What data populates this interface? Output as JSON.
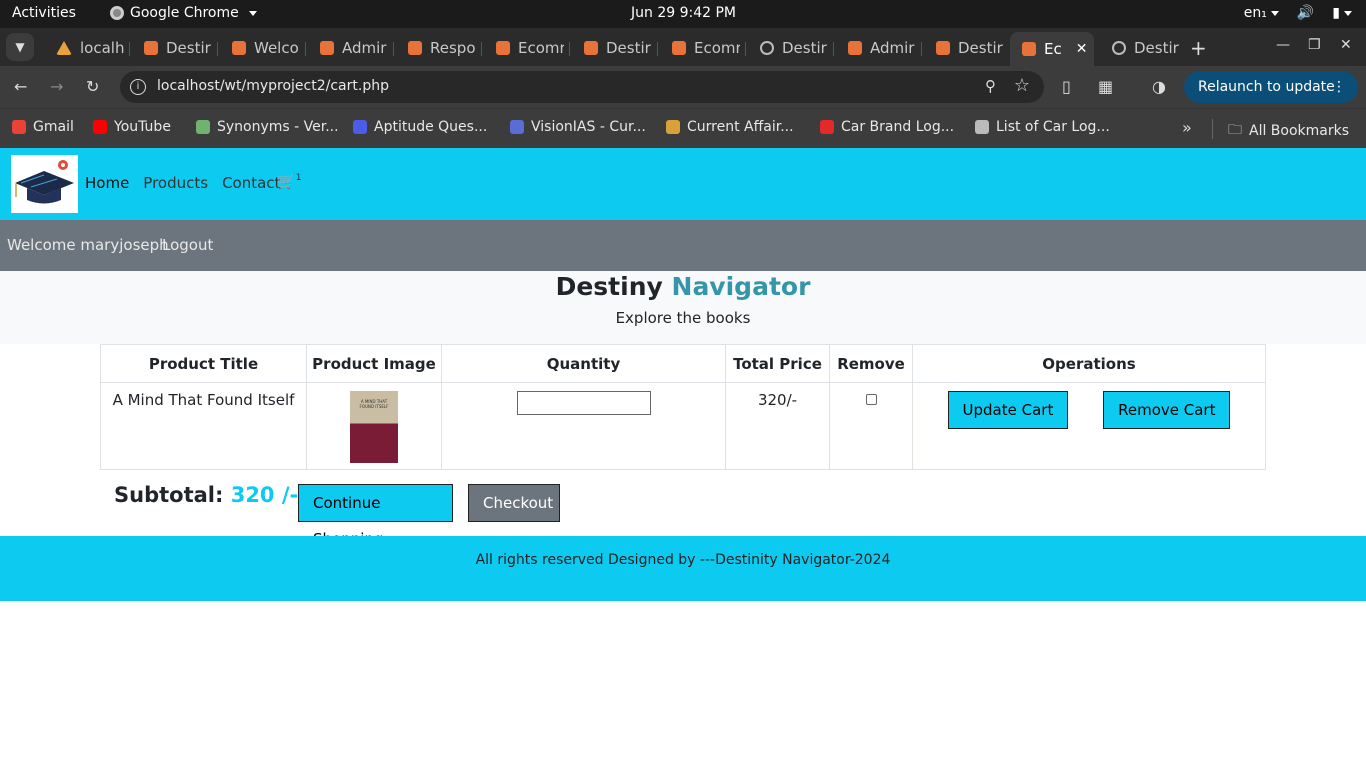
{
  "system_bar": {
    "activities": "Activities",
    "app_name": "Google Chrome",
    "clock": "Jun 29  9:42 PM",
    "keyboard_layout": "en₁"
  },
  "browser": {
    "tabs": [
      {
        "label": "localh",
        "icon": "mountain-icon"
      },
      {
        "label": "Destir",
        "icon": "xampp-icon"
      },
      {
        "label": "Welco",
        "icon": "xampp-icon"
      },
      {
        "label": "Admir",
        "icon": "xampp-icon"
      },
      {
        "label": "Respo",
        "icon": "xampp-icon"
      },
      {
        "label": "Ecomr",
        "icon": "xampp-icon"
      },
      {
        "label": "Destir",
        "icon": "xampp-icon"
      },
      {
        "label": "Ecomr",
        "icon": "xampp-icon"
      },
      {
        "label": "Destir",
        "icon": "globe-icon"
      },
      {
        "label": "Admir",
        "icon": "xampp-icon"
      },
      {
        "label": "Destir",
        "icon": "xampp-icon"
      },
      {
        "label": "Ec",
        "icon": "xampp-icon",
        "active": true
      },
      {
        "label": "Destir",
        "icon": "globe-icon"
      }
    ],
    "url": "localhost/wt/myproject2/cart.php",
    "relaunch_label": "Relaunch to update",
    "bookmarks": [
      {
        "label": "Gmail",
        "color": "#ea4335"
      },
      {
        "label": "YouTube",
        "color": "#ff0000"
      },
      {
        "label": "Synonyms - Ver...",
        "color": "#6fb36f"
      },
      {
        "label": "Aptitude Ques...",
        "color": "#4a5ce8"
      },
      {
        "label": "VisionIAS - Cur...",
        "color": "#5a6dd6"
      },
      {
        "label": "Current Affair...",
        "color": "#d9a13a"
      },
      {
        "label": "Car Brand Log...",
        "color": "#e22a2a"
      },
      {
        "label": "List of Car Log...",
        "color": "#bbbbbb"
      }
    ],
    "all_bookmarks": "All Bookmarks"
  },
  "navbar": {
    "home": "Home",
    "products": "Products",
    "contact": "Contact",
    "cart_count": "1"
  },
  "subnav": {
    "welcome": "Welcome maryjoseph",
    "logout": "Logout"
  },
  "hero": {
    "title_part1": "Destiny",
    "title_part2": "Navigator",
    "subtitle": "Explore the books"
  },
  "cart_table": {
    "headers": [
      "Product Title",
      "Product Image",
      "Quantity",
      "Total Price",
      "Remove",
      "Operations"
    ],
    "rows": [
      {
        "title": "A Mind That Found Itself",
        "total_price": "320/-",
        "quantity": ""
      }
    ],
    "update_label": "Update Cart",
    "remove_label": "Remove Cart"
  },
  "summary": {
    "subtotal_label": "Subtotal:",
    "subtotal_value": "320 /-",
    "continue_label": "Continue Shopping",
    "checkout_label": "Checkout"
  },
  "footer": {
    "text": "All rights reserved Designed by ---Destinity Navigator-2024"
  },
  "colors": {
    "accent": "#0dcaf0",
    "secondary": "#6c757d",
    "title_accent": "#3496a8"
  }
}
